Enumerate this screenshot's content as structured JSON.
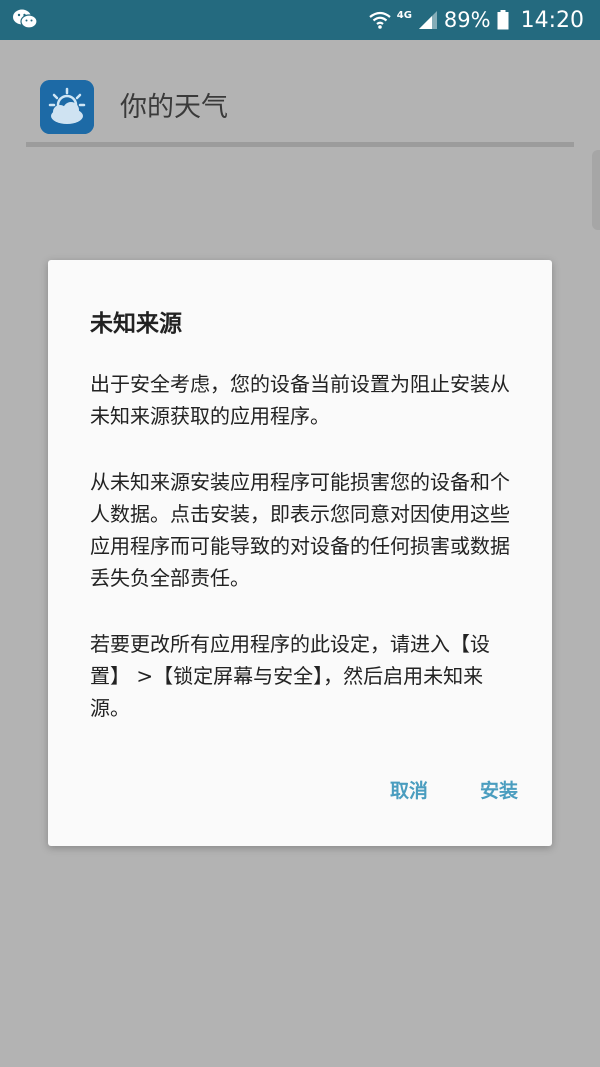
{
  "status_bar": {
    "network": "4G",
    "battery": "89%",
    "time": "14:20",
    "icons": [
      "wechat-icon",
      "wifi-icon",
      "signal-icon",
      "battery-icon"
    ]
  },
  "app": {
    "name": "你的天气",
    "icon": "weather-app-icon"
  },
  "dialog": {
    "title": "未知来源",
    "paragraphs": [
      "出于安全考虑，您的设备当前设置为阻止安装从未知来源获取的应用程序。",
      "从未知来源安装应用程序可能损害您的设备和个人数据。点击安装，即表示您同意对因使用这些应用程序而可能导致的对设备的任何损害或数据丢失负全部责任。",
      "若要更改所有应用程序的此设定，请进入【设置】 >【锁定屏幕与安全】，然后启用未知来源。"
    ],
    "cancel_label": "取消",
    "install_label": "安装"
  },
  "colors": {
    "status_bar": "#246a7f",
    "scrim": "#b3b3b3",
    "accent": "#4a9dbf",
    "dialog_bg": "#fafafa"
  }
}
